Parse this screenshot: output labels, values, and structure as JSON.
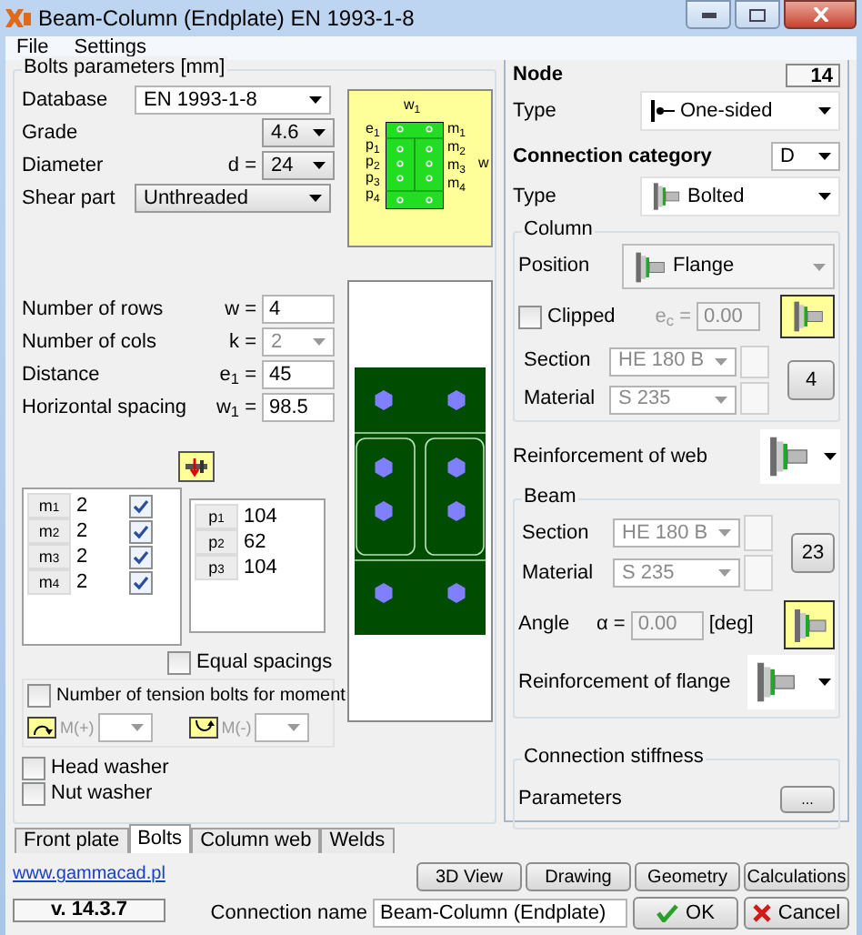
{
  "window": {
    "title": "Beam-Column (Endplate) EN 1993-1-8"
  },
  "menu": [
    "File",
    "Settings"
  ],
  "bolts": {
    "group_title": "Bolts parameters [mm]",
    "fields": [
      {
        "label": "Database",
        "value": "EN 1993-1-8",
        "kind": "wide"
      },
      {
        "label": "Grade",
        "value": "4.6",
        "kind": "short"
      },
      {
        "label": "Diameter",
        "prefix": "d =",
        "value": "24",
        "kind": "short"
      },
      {
        "label": "Shear part",
        "value": "Unthreaded",
        "kind": "button"
      }
    ],
    "scheme": {
      "top": "w$_{1}$",
      "left": [
        "e$_{1}$",
        "p$_{1}$",
        "p$_{2}$",
        "p$_{3}$",
        "p$_{4}$"
      ],
      "right": [
        "m$_{1}$",
        "m$_{2}$",
        "m$_{3}$",
        "m$_{4}$"
      ],
      "side": "w"
    },
    "geometry": [
      {
        "label": "Number of rows",
        "prefix": "w =",
        "value": "4",
        "kind": "input",
        "disabled": false
      },
      {
        "label": "Number of cols",
        "prefix": "k =",
        "value": "2",
        "kind": "dropdown",
        "disabled": true
      },
      {
        "label": "Distance",
        "prefix": "e$_{1}$ =",
        "value": "45",
        "kind": "input",
        "disabled": false
      },
      {
        "label": "Horizontal spacing",
        "prefix": "w$_{1}$ =",
        "value": "98.5",
        "kind": "input",
        "disabled": false
      }
    ],
    "rows": [
      {
        "label": "m$_{1}$",
        "value": "2",
        "checked": true
      },
      {
        "label": "m$_{2}$",
        "value": "2",
        "checked": true
      },
      {
        "label": "m$_{3}$",
        "value": "2",
        "checked": true
      },
      {
        "label": "m$_{4}$",
        "value": "2",
        "checked": true
      }
    ],
    "spacings": [
      {
        "label": "p$_{1}$",
        "value": "104"
      },
      {
        "label": "p$_{2}$",
        "value": "62"
      },
      {
        "label": "p$_{3}$",
        "value": "104"
      }
    ],
    "equal_spacings": {
      "label": "Equal spacings",
      "checked": false
    },
    "tension": {
      "label": "Number of tension bolts for moment",
      "checked": false,
      "positive": "M(+)",
      "negative": "M(-)"
    },
    "washers": [
      {
        "label": "Head washer",
        "checked": false
      },
      {
        "label": "Nut washer",
        "checked": false
      }
    ]
  },
  "tabs": [
    {
      "label": "Front plate",
      "selected": false
    },
    {
      "label": "Bolts",
      "selected": true
    },
    {
      "label": "Column web",
      "selected": false
    },
    {
      "label": "Welds",
      "selected": false
    }
  ],
  "node": {
    "label": "Node",
    "value": "14",
    "type_label": "Type",
    "type_value": "One-sided"
  },
  "category": {
    "label": "Connection category",
    "value": "D",
    "type_label": "Type",
    "type_value": "Bolted"
  },
  "column": {
    "group_title": "Column",
    "position_label": "Position",
    "position_value": "Flange",
    "clipped": {
      "label": "Clipped",
      "checked": false
    },
    "ec_prefix": "e$_{c}$ =",
    "ec_value": "0.00",
    "section_label": "Section",
    "section_value": "HE  180 B",
    "material_label": "Material",
    "material_value": "S 235",
    "count": "4",
    "reinforcement_label": "Reinforcement of web"
  },
  "beam": {
    "group_title": "Beam",
    "section_label": "Section",
    "section_value": "HE  180 B",
    "material_label": "Material",
    "material_value": "S 235",
    "count": "23",
    "angle_label": "Angle",
    "angle_prefix": "α =",
    "angle_value": "0.00",
    "angle_unit": "[deg]",
    "reinforcement_label": "Reinforcement of flange"
  },
  "stiffness": {
    "group_title": "Connection stiffness",
    "label": "Parameters",
    "button": "..."
  },
  "footer": {
    "link": "www.gammacad.pl",
    "version": "v. 14.3.7",
    "buttons": [
      "3D View",
      "Drawing",
      "Geometry",
      "Calculations"
    ],
    "name_label": "Connection name",
    "name_value": "Beam-Column (Endplate)",
    "dialog_buttons": [
      {
        "label": "OK",
        "kind": "ok"
      },
      {
        "label": "Cancel",
        "kind": "cancel"
      }
    ]
  }
}
